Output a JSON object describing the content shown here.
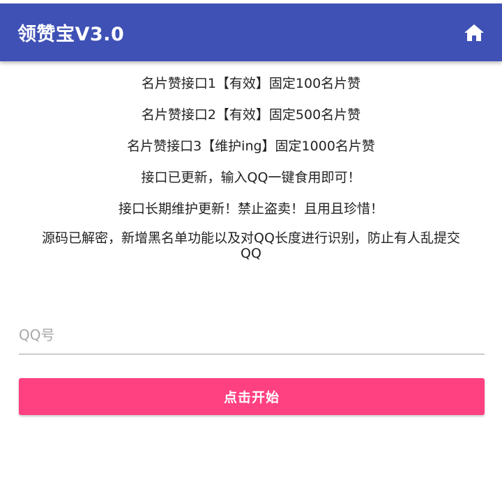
{
  "appbar": {
    "title": "领赞宝V3.0",
    "home_icon": "home-icon",
    "background_color": "#3f51b5"
  },
  "notices": [
    "名片赞接口1【有效】固定100名片赞",
    "名片赞接口2【有效】固定500名片赞",
    "名片赞接口3【维护ing】固定1000名片赞",
    "接口已更新，输入QQ一键食用即可！",
    "接口长期维护更新！禁止盗卖！且用且珍惜！",
    "源码已解密，新增黑名单功能以及对QQ长度进行识别，防止有人乱提交QQ"
  ],
  "form": {
    "qq_placeholder": "QQ号",
    "qq_value": "",
    "start_label": "点击开始",
    "button_color": "#ff4081"
  }
}
